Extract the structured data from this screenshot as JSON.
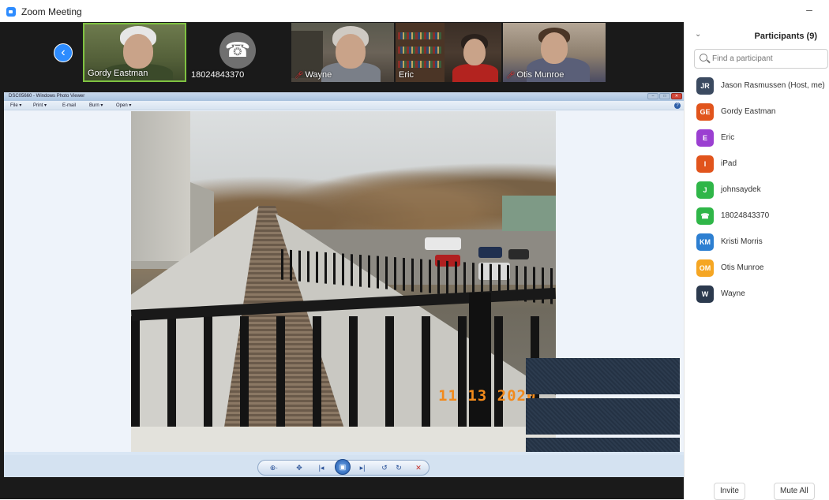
{
  "window": {
    "title": "Zoom Meeting",
    "minimize_label": "–"
  },
  "gallery": {
    "tiles": [
      {
        "name": "Gordy Eastman",
        "muted": false
      },
      {
        "name": "18024843370",
        "muted": false
      },
      {
        "name": "Wayne",
        "muted": true
      },
      {
        "name": "Eric",
        "muted": false
      },
      {
        "name": "Otis Munroe",
        "muted": true
      }
    ]
  },
  "photo_viewer": {
    "title": "DSC05660 - Windows Photo Viewer",
    "menu": [
      "File ▾",
      "Print ▾",
      "E-mail",
      "Burn ▾",
      "Open ▾"
    ],
    "date_stamp": "11 13 2020",
    "controls": [
      "⊕·",
      "✥",
      "|◂",
      "▣",
      "▸|",
      "↺",
      "↻",
      "✕"
    ]
  },
  "participants_panel": {
    "title": "Participants (9)",
    "search_placeholder": "Find a participant",
    "participants": [
      {
        "initials": "JR",
        "name": "Jason Rasmussen (Host, me)",
        "color": "#3b4a60"
      },
      {
        "initials": "GE",
        "name": "Gordy Eastman",
        "color": "#e1541c"
      },
      {
        "initials": "E",
        "name": "Eric",
        "color": "#9b3fd1"
      },
      {
        "initials": "I",
        "name": "iPad",
        "color": "#e1541c"
      },
      {
        "initials": "J",
        "name": "johnsaydek",
        "color": "#2fb648"
      },
      {
        "initials": "☎",
        "name": "18024843370",
        "color": "#2fb648"
      },
      {
        "initials": "KM",
        "name": "Kristi Morris",
        "color": "#2d7fd1"
      },
      {
        "initials": "OM",
        "name": "Otis Munroe",
        "color": "#f5a623"
      },
      {
        "initials": "W",
        "name": "Wayne",
        "color": "#2c3a4e"
      }
    ],
    "invite_label": "Invite",
    "mute_all_label": "Mute All"
  }
}
